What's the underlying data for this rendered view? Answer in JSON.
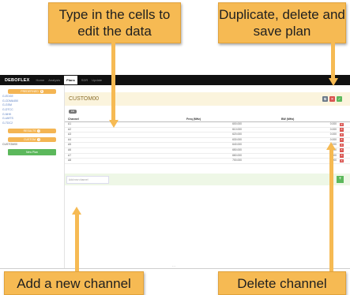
{
  "callouts": {
    "edit_data": "Type in the cells to edit the data",
    "duplicate_delete_save": "Duplicate, delete and save plan",
    "add_channel": "Add a new channel",
    "delete_channel": "Delete channel"
  },
  "app": {
    "brand": "DEBOFLEX",
    "nav": [
      "Home",
      "Analysis",
      "Plans",
      "SDR",
      "Update"
    ],
    "active_nav": "Plans"
  },
  "sidebar": {
    "section1_label": "PREDEFINED",
    "section1_count": "8",
    "plans": [
      "G-EDGE",
      "G-CDMA450",
      "G-GSM",
      "G-DTCC",
      "G-NHK",
      "G-UMTS",
      "G-TDC2"
    ],
    "section2_label": "RESULTS",
    "section2_count": "0",
    "section3_label": "CUSTOM",
    "section3_count": "1",
    "custom_plans": [
      "CUSTOM00"
    ],
    "new_plan_label": "New Plan"
  },
  "plan": {
    "title": "CUSTOM00",
    "tag": "FM",
    "buttons": {
      "duplicate": "⧉",
      "delete": "✕",
      "save": "✓"
    }
  },
  "table": {
    "headers": [
      "Channel",
      "Freq (MHz)",
      "BW (MHz)"
    ],
    "rows": [
      {
        "channel": "A1",
        "freq": "600.000",
        "bw": "0.000"
      },
      {
        "channel": "A2",
        "freq": "610.000",
        "bw": "0.000"
      },
      {
        "channel": "A3",
        "freq": "620.000",
        "bw": "0.000"
      },
      {
        "channel": "A4",
        "freq": "630.000",
        "bw": "0.000"
      },
      {
        "channel": "A5",
        "freq": "640.000",
        "bw": "0.000"
      },
      {
        "channel": "A6",
        "freq": "650.000",
        "bw": "0.000"
      },
      {
        "channel": "A7",
        "freq": "660.000",
        "bw": "0.000"
      },
      {
        "channel": "A8",
        "freq": "700.000",
        "bw": "0.000"
      }
    ],
    "delete_glyph": "✕"
  },
  "add_channel": {
    "placeholder": "Add new channel",
    "plus": "+"
  }
}
